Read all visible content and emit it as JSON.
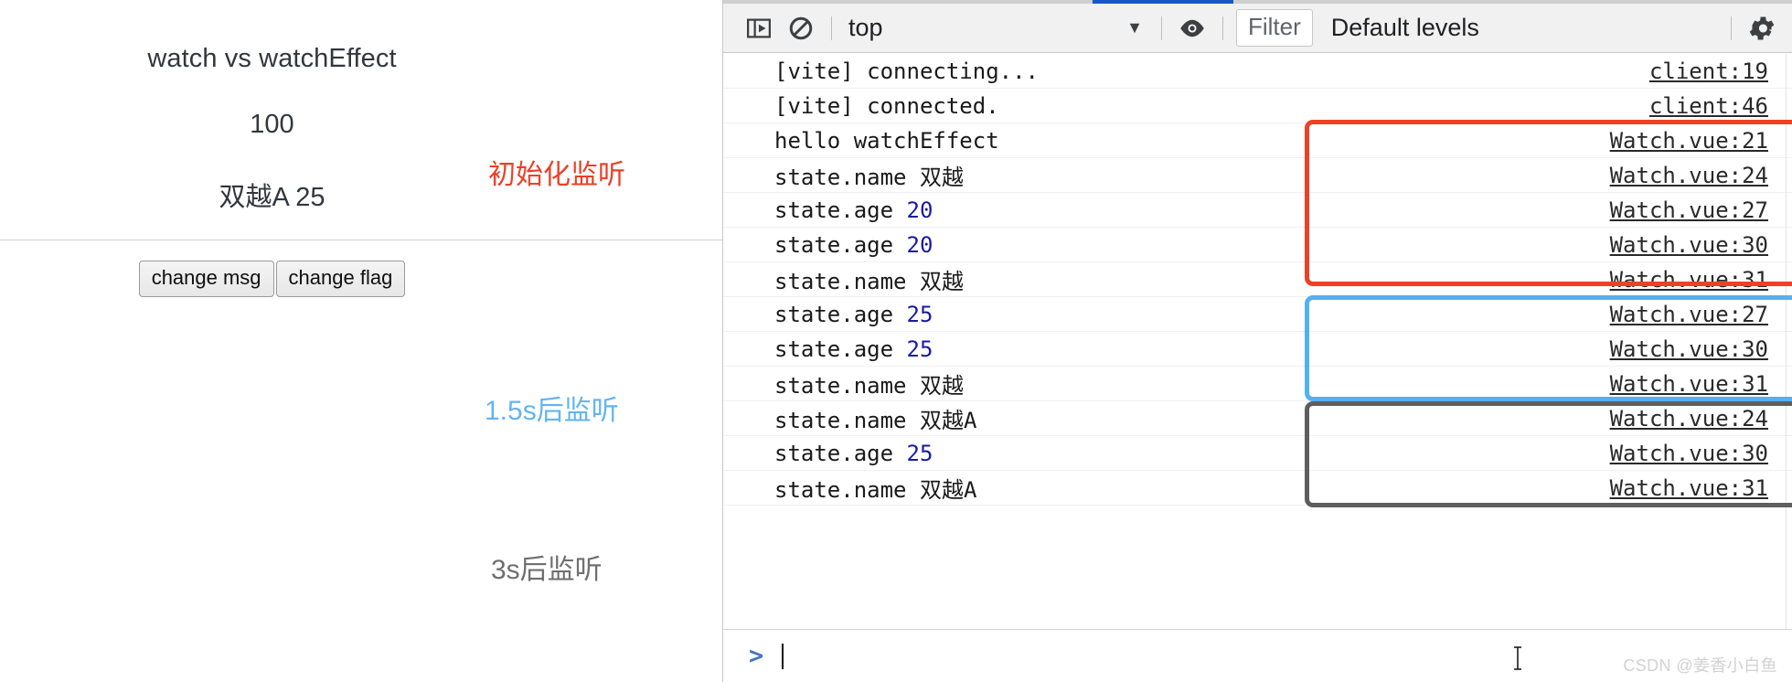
{
  "app_preview": {
    "title": "watch vs watchEffect",
    "count": "100",
    "state_line": "双越A 25",
    "buttons": [
      {
        "label": "change msg",
        "name": "change-msg-button"
      },
      {
        "label": "change flag",
        "name": "change-flag-button"
      }
    ],
    "annotations": [
      {
        "text": "初始化监听",
        "color": "#eb4027"
      },
      {
        "text": "1.5s后监听",
        "color": "#62b4f3"
      },
      {
        "text": "3s后监听",
        "color": "#6f6f6f"
      }
    ]
  },
  "devtools": {
    "toolbar": {
      "sidebar_toggle_icon": "console-sidebar-icon",
      "clear_icon": "clear-console-icon",
      "context_value": "top",
      "context_arrow": "▼",
      "eye_icon": "live-expression-eye-icon",
      "filter_placeholder": "Filter",
      "levels_label": "Default levels",
      "settings_icon": "gear-icon"
    },
    "logs": [
      {
        "message": "[vite] connecting...",
        "number": "",
        "source": "client:19"
      },
      {
        "message": "[vite] connected.",
        "number": "",
        "source": "client:46"
      },
      {
        "message": "hello watchEffect",
        "number": "",
        "source": "Watch.vue:21"
      },
      {
        "message": "state.name 双越",
        "number": "",
        "source": "Watch.vue:24"
      },
      {
        "message": "state.age ",
        "number": "20",
        "source": "Watch.vue:27"
      },
      {
        "message": "state.age ",
        "number": "20",
        "source": "Watch.vue:30"
      },
      {
        "message": "state.name 双越",
        "number": "",
        "source": "Watch.vue:31"
      },
      {
        "message": "state.age ",
        "number": "25",
        "source": "Watch.vue:27"
      },
      {
        "message": "state.age ",
        "number": "25",
        "source": "Watch.vue:30"
      },
      {
        "message": "state.name 双越",
        "number": "",
        "source": "Watch.vue:31"
      },
      {
        "message": "state.name 双越A",
        "number": "",
        "source": "Watch.vue:24"
      },
      {
        "message": "state.age ",
        "number": "25",
        "source": "Watch.vue:30"
      },
      {
        "message": "state.name 双越A",
        "number": "",
        "source": "Watch.vue:31"
      }
    ],
    "highlight_groups": [
      {
        "label": "初始化监听",
        "color": "#ec4126",
        "first_row": 2,
        "last_row": 6
      },
      {
        "label": "1.5s后监听",
        "color": "#55b0f2",
        "first_row": 7,
        "last_row": 9
      },
      {
        "label": "3s后监听",
        "color": "#5e5e5e",
        "first_row": 10,
        "last_row": 12
      }
    ],
    "prompt": {
      "chevron": ">",
      "value": ""
    }
  },
  "watermark": "CSDN @姜香小白鱼"
}
